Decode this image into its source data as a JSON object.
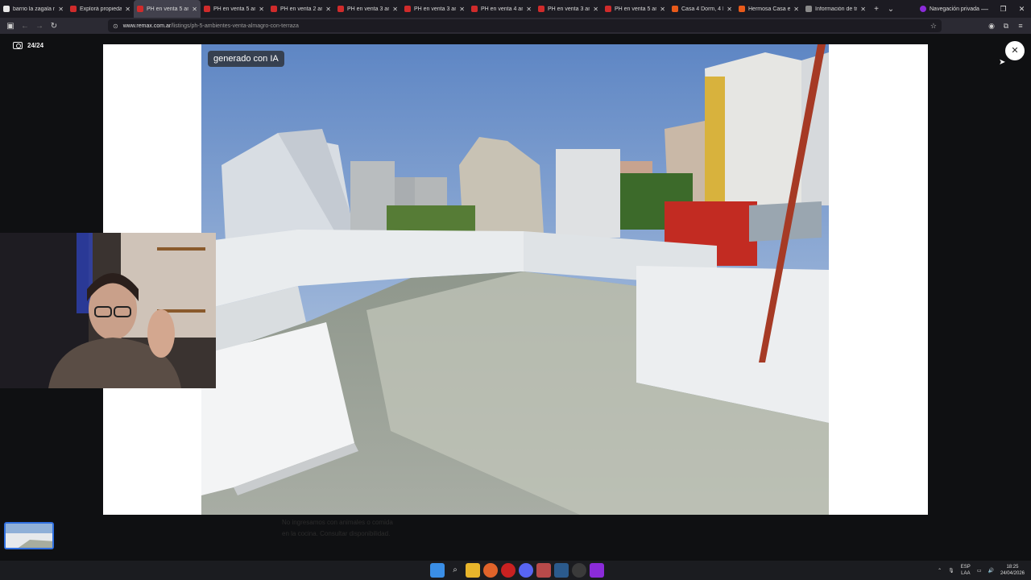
{
  "tabs": [
    {
      "title": "barrio la zagala neu",
      "color": "#e8e8e8"
    },
    {
      "title": "Explorá propiedade",
      "color": "#d02b2b"
    },
    {
      "title": "PH en venta 5 ambi",
      "color": "#d02b2b",
      "active": true
    },
    {
      "title": "PH en venta 5 ambi",
      "color": "#d02b2b"
    },
    {
      "title": "PH en venta 2 ambi",
      "color": "#d02b2b"
    },
    {
      "title": "PH en venta 3 ambi",
      "color": "#d02b2b"
    },
    {
      "title": "PH en venta 3 ambi",
      "color": "#d02b2b"
    },
    {
      "title": "PH en venta 4 ambi",
      "color": "#d02b2b"
    },
    {
      "title": "PH en venta 3 ambi",
      "color": "#d02b2b"
    },
    {
      "title": "PH en venta 5 ambi",
      "color": "#d02b2b"
    },
    {
      "title": "Casa 4 Dorm, 4 Bañ",
      "color": "#e85a1a"
    },
    {
      "title": "Hermosa Casa en V",
      "color": "#e85a1a"
    },
    {
      "title": "Información de tráf",
      "color": "#8a8a8a"
    }
  ],
  "private_label": "Navegación privada",
  "url": {
    "host": "www.remax.com.ar",
    "path": "/listings/ph-5-ambientes-venta-almagro-con-terraza"
  },
  "gallery": {
    "counter": "24/24",
    "ai_badge": "generado con IA",
    "close_symbol": "✕"
  },
  "behind_text": [
    "No ingresamos con animales o comida",
    "en la cocina. Consultar disponibilidad."
  ],
  "tray": {
    "lang": "ESP",
    "layout": "LAA",
    "time": "18:25",
    "date": "24/04/2026"
  },
  "colors": {
    "accent": "#2f6fe0",
    "tab_active": "#42414d",
    "private": "#8b2bd9"
  },
  "icons": [
    "camera-icon",
    "close-icon",
    "windows-start-icon",
    "search-icon",
    "file-explorer-icon",
    "firefox-icon",
    "tor-icon",
    "discord-icon",
    "mail-icon",
    "steam-icon",
    "obs-icon",
    "private-browser-icon"
  ]
}
